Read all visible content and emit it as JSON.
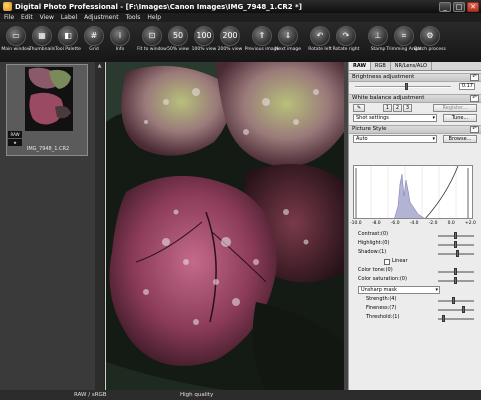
{
  "window": {
    "title": "Digital Photo Professional - [F:\\Images\\Canon Images\\IMG_7948_1.CR2 *]",
    "controls": {
      "minimize": "_",
      "maximize": "□",
      "close": "✕"
    }
  },
  "menu": [
    "File",
    "Edit",
    "View",
    "Label",
    "Adjustment",
    "Tools",
    "Help"
  ],
  "toolbar": {
    "items": [
      {
        "label": "Main window",
        "icon": "window-icon"
      },
      {
        "label": "Thumbnails",
        "icon": "thumbnails-icon"
      },
      {
        "label": "Tool Palette",
        "icon": "palette-icon"
      },
      {
        "label": "Grid",
        "icon": "grid-icon"
      },
      {
        "label": "Info",
        "icon": "info-icon"
      },
      {
        "label": "Fit to window",
        "icon": "fit-icon"
      },
      {
        "label": "50% view",
        "icon": "zoom-50-icon"
      },
      {
        "label": "100% view",
        "icon": "zoom-100-icon"
      },
      {
        "label": "200% view",
        "icon": "zoom-200-icon"
      },
      {
        "label": "Previous image",
        "icon": "previous-icon"
      },
      {
        "label": "Next image",
        "icon": "next-icon"
      },
      {
        "label": "Rotate left",
        "icon": "rotate-left-icon"
      },
      {
        "label": "Rotate right",
        "icon": "rotate-right-icon"
      },
      {
        "label": "Stamp",
        "icon": "stamp-icon"
      },
      {
        "label": "Trimming Angle",
        "icon": "trim-icon"
      },
      {
        "label": "Batch process",
        "icon": "batch-icon"
      }
    ]
  },
  "thumbnail": {
    "filename": "IMG_7948_1.CR2",
    "badges": [
      "RAW",
      "★"
    ]
  },
  "tool_palette": {
    "tabs": [
      "RAW",
      "RGB",
      "NR/Lens/ALO"
    ],
    "active_tab": "RAW",
    "brightness": {
      "label": "Brightness adjustment",
      "value": "0.17"
    },
    "white_balance": {
      "label": "White balance adjustment",
      "presets": [
        "1",
        "2",
        "3"
      ],
      "register_label": "Register...",
      "setting": "Shot settings",
      "tune_label": "Tune..."
    },
    "picture_style": {
      "label": "Picture Style",
      "selected": "Auto",
      "browse_label": "Browse...",
      "axis": [
        "-10.0",
        "-8.0",
        "-6.0",
        "-4.0",
        "-2.0",
        "0.0",
        "+2.0"
      ],
      "contrast": {
        "label": "Contrast:(0)",
        "level": 0.5
      },
      "highlight": {
        "label": "Highlight:(0)",
        "level": 0.5
      },
      "shadow": {
        "label": "Shadow:(1)",
        "level": 0.55
      },
      "linear_label": "Linear",
      "color_tone": {
        "label": "Color tone:(0)",
        "level": 0.5
      },
      "color_saturation": {
        "label": "Color saturation:(0)",
        "level": 0.5
      },
      "sharpness_mode": "Unsharp mask",
      "strength": {
        "label": "Strength:(4)",
        "level": 0.4
      },
      "fineness": {
        "label": "Fineness:(7)",
        "level": 0.7
      },
      "threshold": {
        "label": "Threshold:(1)",
        "level": 0.1
      }
    },
    "reset_glyph": "↶"
  },
  "status": {
    "color_space": "RAW / sRGB",
    "quality": "High quality"
  },
  "colors": {
    "titlebar": "#1a1a1a",
    "toolbar": "#222222",
    "palette_bg": "#ececec",
    "histogram_fill": "#b3b3d6"
  }
}
